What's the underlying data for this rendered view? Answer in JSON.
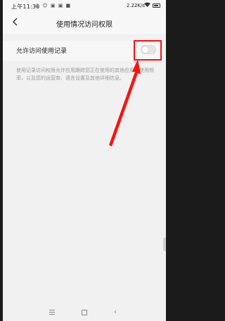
{
  "status_bar": {
    "time": "上午11:36",
    "icons": "◎ ☺ ▣ ▣ ■",
    "network_speed": "2.22K/s",
    "wifi_icon": "wifi-icon",
    "battery_icon": "battery-icon"
  },
  "header": {
    "back_icon": "‹",
    "title": "使用情况访问权限"
  },
  "setting": {
    "label": "允许访问使用记录",
    "enabled": false,
    "description": "使用记录访问权限允许应用跟踪您正在使用的其他应用和使用频率，以及您的运营商、语言设置及其他详细信息。"
  },
  "annotation": {
    "color": "#ff1010"
  },
  "navbar": {
    "back_glyph": "‹"
  }
}
